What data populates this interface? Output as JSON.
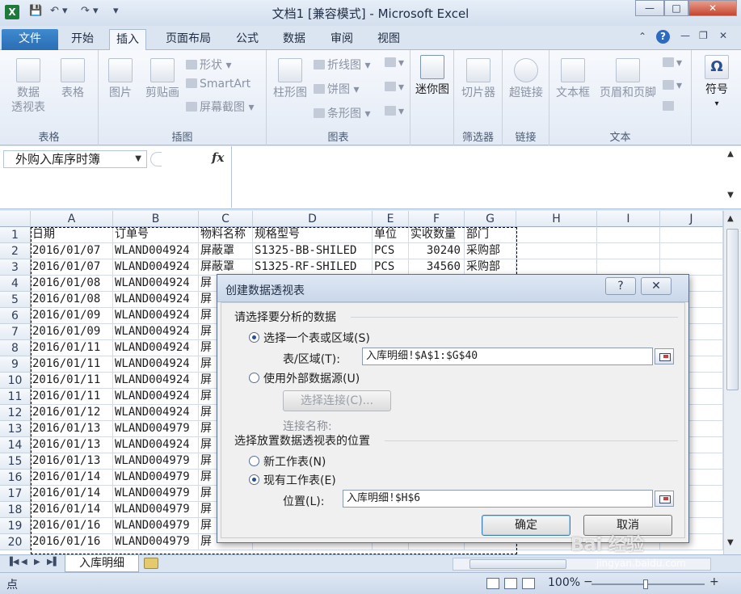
{
  "window": {
    "title": "文档1  [兼容模式] - Microsoft Excel",
    "logo": "X",
    "minimize": "—",
    "restore": "□",
    "close": "✕"
  },
  "quick_access": {
    "save": "💾",
    "undo": "↶ ▾",
    "redo": "↷ ▾",
    "customize": "▾"
  },
  "tabs": [
    "文件",
    "开始",
    "插入",
    "页面布局",
    "公式",
    "数据",
    "审阅",
    "视图"
  ],
  "ribbon": {
    "groups": {
      "tables": "表格",
      "illustrations": "插图",
      "charts": "图表",
      "filters": "筛选器",
      "links": "链接",
      "text": "文本"
    },
    "pivot_line1": "数据",
    "pivot_line2": "透视表",
    "table": "表格",
    "picture": "图片",
    "clipart": "剪贴画",
    "shapes": "形状",
    "smartart": "SmartArt",
    "screenshot": "屏幕截图",
    "column_chart": "柱形图",
    "line_chart": "折线图",
    "pie_chart": "饼图",
    "bar_chart": "条形图",
    "sparklines": "迷你图",
    "slicer": "切片器",
    "hyperlink": "超链接",
    "textbox": "文本框",
    "header_footer": "页眉和页脚",
    "symbol": "符号",
    "symbol_glyph": "Ω"
  },
  "formula_bar": {
    "name_box": "外购入库序时簿",
    "fx": "fx",
    "value": ""
  },
  "columns": [
    "A",
    "B",
    "C",
    "D",
    "E",
    "F",
    "G",
    "H",
    "I",
    "J"
  ],
  "headers_row": [
    "日期",
    "订单号",
    "物料名称",
    "规格型号",
    "单位",
    "实收数量",
    "部门"
  ],
  "rows": [
    [
      "2016/01/07",
      "WLAND004924",
      "屏蔽罩",
      "S1325-BB-SHILED",
      "PCS",
      "30240",
      "采购部"
    ],
    [
      "2016/01/07",
      "WLAND004924",
      "屏蔽罩",
      "S1325-RF-SHILED",
      "PCS",
      "34560",
      "采购部"
    ],
    [
      "2016/01/08",
      "WLAND004924",
      "屏"
    ],
    [
      "2016/01/08",
      "WLAND004924",
      "屏"
    ],
    [
      "2016/01/09",
      "WLAND004924",
      "屏"
    ],
    [
      "2016/01/09",
      "WLAND004924",
      "屏"
    ],
    [
      "2016/01/11",
      "WLAND004924",
      "屏"
    ],
    [
      "2016/01/11",
      "WLAND004924",
      "屏"
    ],
    [
      "2016/01/11",
      "WLAND004924",
      "屏"
    ],
    [
      "2016/01/11",
      "WLAND004924",
      "屏"
    ],
    [
      "2016/01/12",
      "WLAND004924",
      "屏"
    ],
    [
      "2016/01/13",
      "WLAND004979",
      "屏"
    ],
    [
      "2016/01/13",
      "WLAND004924",
      "屏"
    ],
    [
      "2016/01/13",
      "WLAND004979",
      "屏"
    ],
    [
      "2016/01/14",
      "WLAND004979",
      "屏"
    ],
    [
      "2016/01/14",
      "WLAND004979",
      "屏"
    ],
    [
      "2016/01/14",
      "WLAND004979",
      "屏"
    ],
    [
      "2016/01/16",
      "WLAND004979",
      "屏"
    ],
    [
      "2016/01/16",
      "WLAND004979",
      "屏"
    ]
  ],
  "sheet_tab": "入库明细",
  "status": {
    "mode": "点",
    "zoom": "100%",
    "zoom_minus": "−",
    "zoom_plus": "+"
  },
  "dialog": {
    "title": "创建数据透视表",
    "help": "?",
    "close": "✕",
    "section1": "请选择要分析的数据",
    "opt_select_range": "选择一个表或区域(S)",
    "range_label": "表/区域(T):",
    "range_value": "入库明细!$A$1:$G$40",
    "opt_external": "使用外部数据源(U)",
    "choose_connection": "选择连接(C)...",
    "connection_name_label": "连接名称:",
    "section2": "选择放置数据透视表的位置",
    "opt_new_sheet": "新工作表(N)",
    "opt_existing_sheet": "现有工作表(E)",
    "location_label": "位置(L):",
    "location_value": "入库明细!$H$6",
    "ok": "确定",
    "cancel": "取消"
  },
  "watermark": {
    "logo": "Bai 经验",
    "url": "jingyan.baidu.com"
  }
}
